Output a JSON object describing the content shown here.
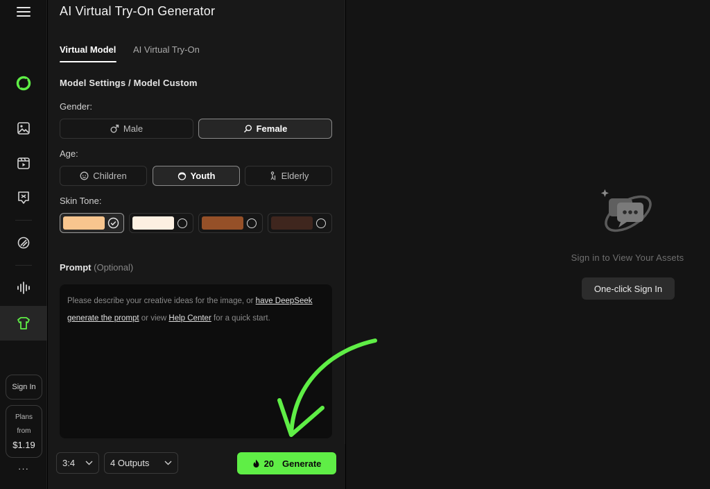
{
  "app": {
    "title": "AI Virtual Try-On Generator"
  },
  "tabs": [
    {
      "label": "Virtual Model",
      "active": true
    },
    {
      "label": "AI Virtual Try-On",
      "active": false
    }
  ],
  "settings": {
    "section_title": "Model Settings / Model Custom",
    "gender": {
      "label": "Gender:",
      "options": [
        {
          "label": "Male",
          "icon": "male-icon",
          "selected": false
        },
        {
          "label": "Female",
          "icon": "female-icon",
          "selected": true
        }
      ]
    },
    "age": {
      "label": "Age:",
      "options": [
        {
          "label": "Children",
          "icon": "child-face-icon",
          "selected": false
        },
        {
          "label": "Youth",
          "icon": "youth-face-icon",
          "selected": true
        },
        {
          "label": "Elderly",
          "icon": "elderly-icon",
          "selected": false
        }
      ]
    },
    "skin_tone": {
      "label": "Skin Tone:",
      "options": [
        {
          "color": "#f8c58e",
          "selected": true
        },
        {
          "color": "#fdf0e2",
          "selected": false
        },
        {
          "color": "#955028",
          "selected": false
        },
        {
          "color": "#3f261e",
          "selected": false
        }
      ]
    }
  },
  "prompt": {
    "label": "Prompt",
    "optional": "(Optional)",
    "text_1": "Please describe your creative ideas for the image, or ",
    "link_1": "have DeepSeek generate the prompt",
    "text_2": " or view ",
    "link_2": "Help Center",
    "text_3": " for a quick start."
  },
  "footer": {
    "ratio": "3:4",
    "outputs": "4 Outputs",
    "credits": "20",
    "generate_label": "Generate",
    "accent": "#5fee46"
  },
  "sidebar": {
    "signin_label": "Sign In",
    "plans_line1": "Plans",
    "plans_line2": "from",
    "plans_price": "$1.19",
    "more": "···"
  },
  "assets": {
    "empty_text": "Sign in to View Your Assets",
    "signin_button": "One-click Sign In"
  }
}
